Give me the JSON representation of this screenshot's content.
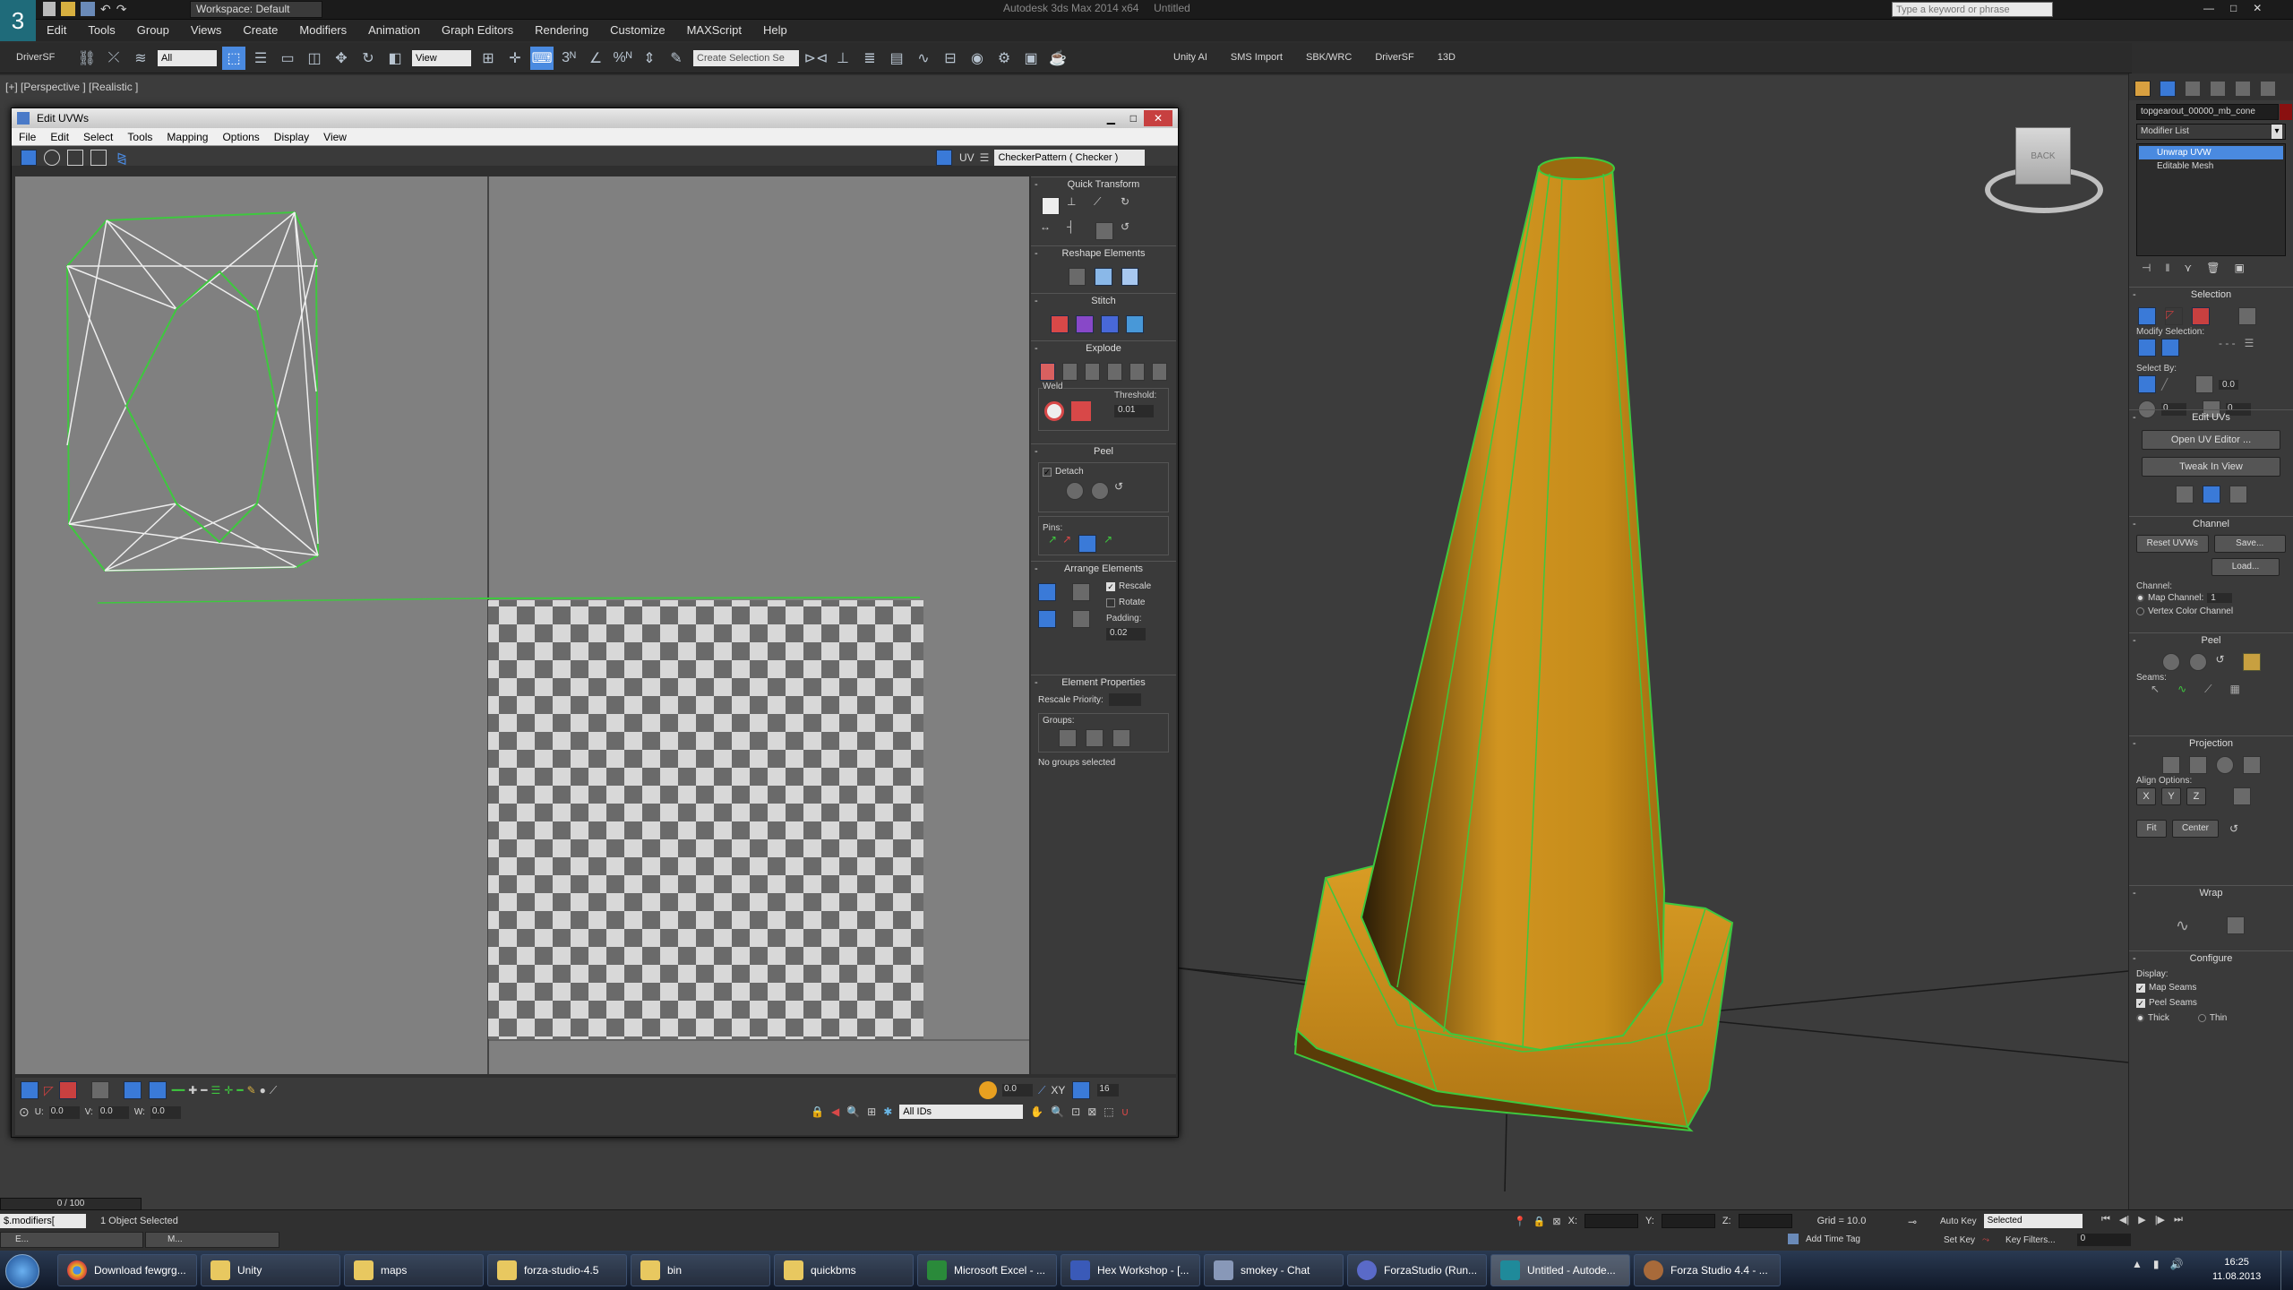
{
  "app": {
    "title": "Autodesk 3ds Max 2014 x64",
    "document": "Untitled",
    "workspace": "Workspace: Default",
    "search_placeholder": "Type a keyword or phrase"
  },
  "menubar": [
    "Edit",
    "Tools",
    "Group",
    "Views",
    "Create",
    "Modifiers",
    "Animation",
    "Graph Editors",
    "Rendering",
    "Customize",
    "MAXScript",
    "Help"
  ],
  "toolbar": {
    "left_label": "DriverSF",
    "filter_select": "All",
    "view_select": "View",
    "selection_set": "Create Selection Se",
    "plugin_labels": [
      "Unity AI",
      "SMS Import",
      "SBK/WRC",
      "DriverSF",
      "13D"
    ]
  },
  "viewport": {
    "label": "[+] [Perspective ] [Realistic ]",
    "viewcube_label": "BACK"
  },
  "uv_editor": {
    "title": "Edit UVWs",
    "menu": [
      "File",
      "Edit",
      "Select",
      "Tools",
      "Mapping",
      "Options",
      "Display",
      "View"
    ],
    "uv_label": "UV",
    "texture_select": "CheckerPattern  ( Checker )",
    "quick_transform": "Quick Transform",
    "reshape": "Reshape Elements",
    "stitch": "Stitch",
    "explode": "Explode",
    "weld": "Weld",
    "threshold_label": "Threshold:",
    "threshold_value": "0.01",
    "peel": "Peel",
    "detach": "Detach",
    "pins": "Pins:",
    "arrange": "Arrange Elements",
    "rescale": "Rescale",
    "rotate": "Rotate",
    "padding_label": "Padding:",
    "padding_value": "0.02",
    "element_props": "Element Properties",
    "rescale_priority": "Rescale Priority:",
    "groups": "Groups:",
    "no_groups": "No groups selected",
    "u_label": "U:",
    "u_value": "0.0",
    "v_label": "V:",
    "v_value": "0.0",
    "w_label": "W:",
    "w_value": "0.0",
    "soft_value": "0.0",
    "xy_label": "XY",
    "grid_value": "16",
    "ids_select": "All IDs"
  },
  "command_panel": {
    "object_name": "topgearout_00000_mb_cone",
    "modifier_list": "Modifier List",
    "stack": [
      "Unwrap UVW",
      "Editable Mesh"
    ],
    "selection": "Selection",
    "modify_selection": "Modify Selection:",
    "select_by": "Select By:",
    "angle_value": "0.0",
    "edit_uvs": "Edit UVs",
    "open_uv_editor": "Open UV Editor ...",
    "tweak_in_view": "Tweak In View",
    "channel": "Channel",
    "reset_uvws": "Reset UVWs",
    "save": "Save...",
    "load": "Load...",
    "channel_label": "Channel:",
    "map_channel": "Map Channel:",
    "map_channel_value": "1",
    "vertex_color": "Vertex Color Channel",
    "peel": "Peel",
    "seams": "Seams:",
    "projection": "Projection",
    "align_options": "Align Options:",
    "axes": [
      "X",
      "Y",
      "Z"
    ],
    "fit": "Fit",
    "center": "Center",
    "wrap": "Wrap",
    "configure": "Configure",
    "display": "Display:",
    "map_seams": "Map Seams",
    "peel_seams": "Peel Seams",
    "thick": "Thick",
    "thin": "Thin"
  },
  "status": {
    "timeline": "0 / 100",
    "script_listener": "$.modifiers[",
    "selected_text": "1 Object Selected",
    "x_label": "X:",
    "y_label": "Y:",
    "z_label": "Z:",
    "grid": "Grid = 10.0",
    "add_time_tag": "Add Time Tag",
    "auto_key": "Auto Key",
    "set_key": "Set Key",
    "selected_select": "Selected",
    "key_filters": "Key Filters...",
    "frame_value": "0",
    "minis": [
      "E...",
      "M..."
    ]
  },
  "taskbar": {
    "items": [
      "Download fewgrg...",
      "Unity",
      "maps",
      "forza-studio-4.5",
      "bin",
      "quickbms",
      "Microsoft Excel - ...",
      "Hex Workshop - [...",
      "smokey - Chat",
      "ForzaStudio (Run...",
      "Untitled - Autode...",
      "Forza Studio 4.4 - ..."
    ],
    "time": "16:25",
    "date": "11.08.2013"
  },
  "colors": {
    "accent": "#4a8ae0",
    "seam_green": "#3ec83e",
    "cone_orange": "#c8901e"
  }
}
